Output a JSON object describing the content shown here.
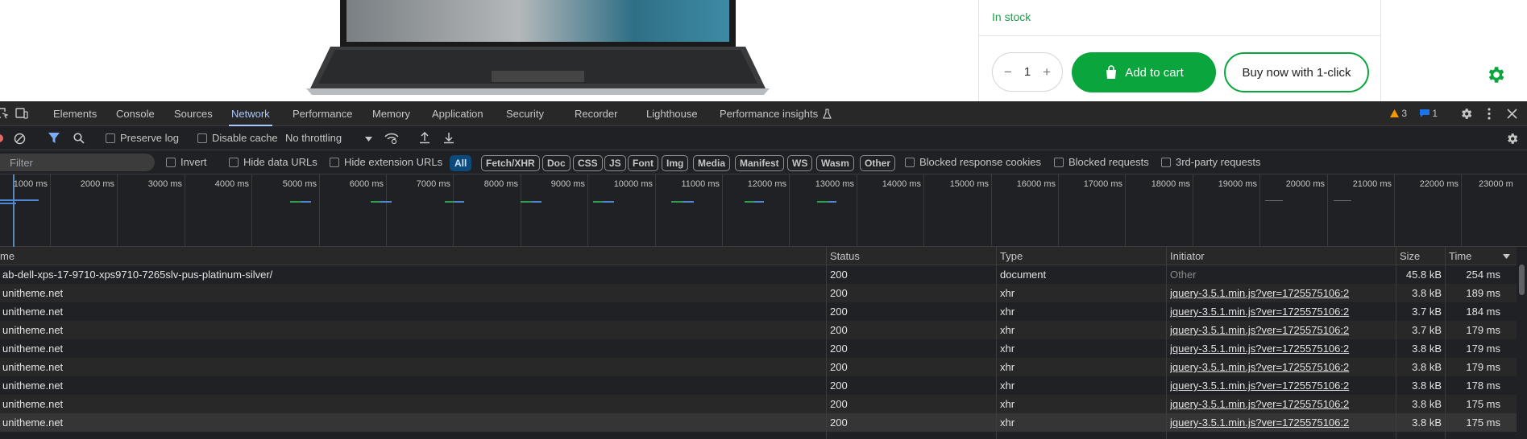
{
  "product": {
    "stock": "In stock",
    "qty": {
      "minus": "−",
      "value": "1",
      "plus": "+"
    },
    "add_to_cart": "Add to cart",
    "buy_now": "Buy now with 1-click"
  },
  "devtools": {
    "tabs": [
      "Elements",
      "Console",
      "Sources",
      "Network",
      "Performance",
      "Memory",
      "Application",
      "Security",
      "Recorder",
      "Lighthouse",
      "Performance insights"
    ],
    "active_tab": "Network",
    "warnings": "3",
    "messages": "1",
    "toolbar": {
      "preserve_log": "Preserve log",
      "disable_cache": "Disable cache",
      "throttling": "No throttling"
    },
    "filterbar": {
      "filter_placeholder": "Filter",
      "invert": "Invert",
      "hide_data_urls": "Hide data URLs",
      "hide_extension_urls": "Hide extension URLs",
      "chips": [
        "All",
        "Fetch/XHR",
        "Doc",
        "CSS",
        "JS",
        "Font",
        "Img",
        "Media",
        "Manifest",
        "WS",
        "Wasm",
        "Other"
      ],
      "blocked_response_cookies": "Blocked response cookies",
      "blocked_requests": "Blocked requests",
      "third_party": "3rd-party requests"
    },
    "overview_ticks": [
      "1000 ms",
      "2000 ms",
      "3000 ms",
      "4000 ms",
      "5000 ms",
      "6000 ms",
      "7000 ms",
      "8000 ms",
      "9000 ms",
      "10000 ms",
      "11000 ms",
      "12000 ms",
      "13000 ms",
      "14000 ms",
      "15000 ms",
      "16000 ms",
      "17000 ms",
      "18000 ms",
      "19000 ms",
      "20000 ms",
      "21000 ms",
      "22000 ms",
      "23000 m"
    ],
    "columns": {
      "name": "me",
      "status": "Status",
      "type": "Type",
      "initiator": "Initiator",
      "size": "Size",
      "time": "Time"
    },
    "rows": [
      {
        "name": "ab-dell-xps-17-9710-xps9710-7265slv-pus-platinum-silver/",
        "status": "200",
        "type": "document",
        "initiator": "Other",
        "size": "45.8 kB",
        "time": "254 ms"
      },
      {
        "name": "unitheme.net",
        "status": "200",
        "type": "xhr",
        "initiator": "jquery-3.5.1.min.js?ver=1725575106:2",
        "size": "3.8 kB",
        "time": "189 ms"
      },
      {
        "name": "unitheme.net",
        "status": "200",
        "type": "xhr",
        "initiator": "jquery-3.5.1.min.js?ver=1725575106:2",
        "size": "3.7 kB",
        "time": "184 ms"
      },
      {
        "name": "unitheme.net",
        "status": "200",
        "type": "xhr",
        "initiator": "jquery-3.5.1.min.js?ver=1725575106:2",
        "size": "3.7 kB",
        "time": "179 ms"
      },
      {
        "name": "unitheme.net",
        "status": "200",
        "type": "xhr",
        "initiator": "jquery-3.5.1.min.js?ver=1725575106:2",
        "size": "3.8 kB",
        "time": "179 ms"
      },
      {
        "name": "unitheme.net",
        "status": "200",
        "type": "xhr",
        "initiator": "jquery-3.5.1.min.js?ver=1725575106:2",
        "size": "3.8 kB",
        "time": "179 ms"
      },
      {
        "name": "unitheme.net",
        "status": "200",
        "type": "xhr",
        "initiator": "jquery-3.5.1.min.js?ver=1725575106:2",
        "size": "3.8 kB",
        "time": "178 ms"
      },
      {
        "name": "unitheme.net",
        "status": "200",
        "type": "xhr",
        "initiator": "jquery-3.5.1.min.js?ver=1725575106:2",
        "size": "3.8 kB",
        "time": "175 ms"
      },
      {
        "name": "unitheme.net",
        "status": "200",
        "type": "xhr",
        "initiator": "jquery-3.5.1.min.js?ver=1725575106:2",
        "size": "3.8 kB",
        "time": "175 ms"
      }
    ]
  }
}
